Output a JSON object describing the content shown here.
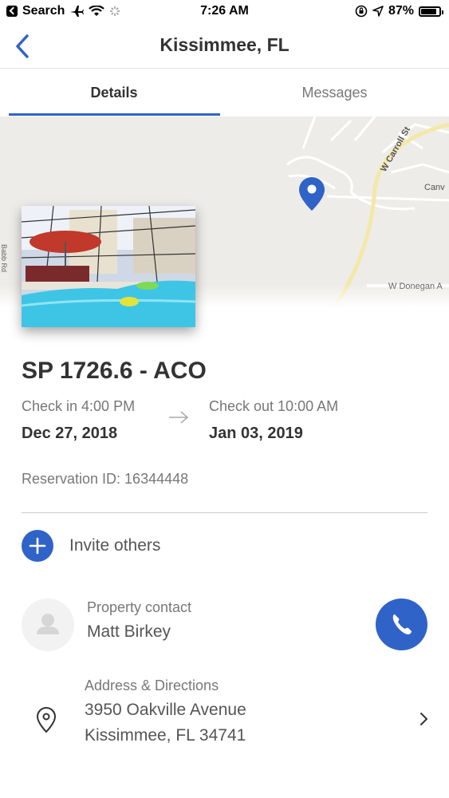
{
  "status_bar": {
    "back_app": "Search",
    "time": "7:26 AM",
    "battery": "87%",
    "battery_level": 0.87
  },
  "nav": {
    "title": "Kissimmee, FL",
    "back_icon": "chevron-left-icon"
  },
  "tabs": [
    {
      "label": "Details",
      "selected": true
    },
    {
      "label": "Messages",
      "selected": false
    }
  ],
  "map": {
    "streets": [
      "W Carroll St",
      "Canv",
      "W Donegan A",
      "Babb Rd"
    ]
  },
  "reservation": {
    "property_name": "SP 1726.6 - ACO",
    "check_in_label": "Check in 4:00 PM",
    "check_in_date": "Dec 27, 2018",
    "check_out_label": "Check out 10:00 AM",
    "check_out_date": "Jan 03, 2019",
    "reservation_id": "Reservation ID: 16344448"
  },
  "invite": {
    "label": "Invite others"
  },
  "contact": {
    "label": "Property contact",
    "name": "Matt Birkey"
  },
  "address": {
    "label": "Address & Directions",
    "line1": "3950 Oakville Avenue",
    "line2": "Kissimmee, FL 34741"
  },
  "colors": {
    "accent": "#2f63c8",
    "map_bg": "#eeece8",
    "map_road": "#f7e9a0"
  }
}
